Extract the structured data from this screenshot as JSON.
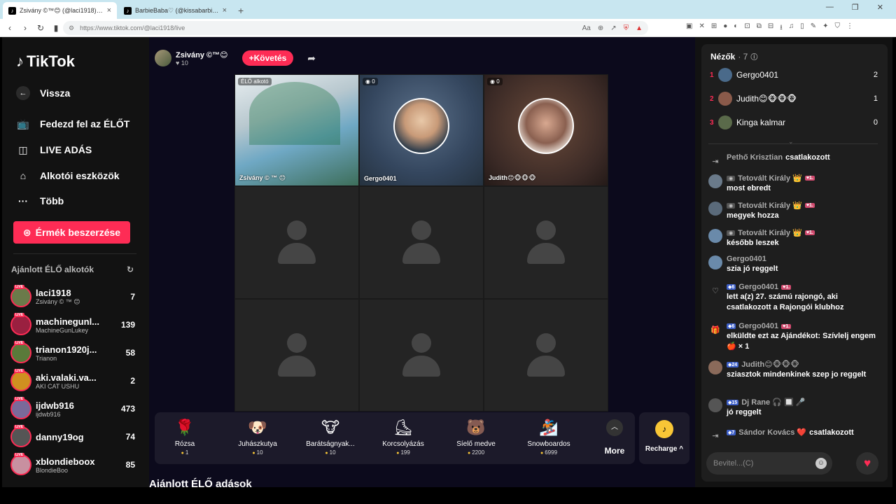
{
  "browser": {
    "tabs": [
      {
        "title": "Zsivány ©™😊 (@laci1918) É...",
        "active": true
      },
      {
        "title": "BarbieBaba♡ (@kissabarbie) ÉLŐ ad...",
        "active": false
      }
    ],
    "url": "https://www.tiktok.com/@laci1918/live"
  },
  "leftnav": {
    "logo": "TikTok",
    "back": "Vissza",
    "explore": "Fedezd fel az ÉLŐT",
    "live": "LIVE ADÁS",
    "tools": "Alkotói eszközök",
    "more": "Több",
    "coins": "Érmék beszerzése",
    "rec_title": "Ajánlott ÉLŐ alkotók",
    "creators": [
      {
        "name": "laci1918",
        "sub": "Zsivány © ™ 😊",
        "count": "7",
        "color": "#6b7a4a"
      },
      {
        "name": "machinegunl...",
        "sub": "MachineGunLukey",
        "count": "139",
        "color": "#9a2040"
      },
      {
        "name": "trianon1920j...",
        "sub": "Trianon",
        "count": "58",
        "color": "#5a7a3a"
      },
      {
        "name": "aki.valaki.va...",
        "sub": "AKI CAT USHU",
        "count": "2",
        "color": "#d09020"
      },
      {
        "name": "ijdwb916",
        "sub": "ijdwb916",
        "count": "473",
        "color": "#7a6a9a"
      },
      {
        "name": "danny19og",
        "sub": "",
        "count": "74",
        "color": "#555555"
      },
      {
        "name": "xblondieboox",
        "sub": "BlondieBoo",
        "count": "85",
        "color": "#c890a0"
      }
    ]
  },
  "stream": {
    "host": "Zsivány ©™😊",
    "viewers": "10",
    "follow": "+Követés",
    "cells": [
      {
        "badge": "ÉLŐ alkotó",
        "name": "Zsivány © ™ 😊"
      },
      {
        "badge": "0",
        "name": "Gergo0401"
      },
      {
        "badge": "0",
        "name": "Judith😊🐵🐵🐵"
      }
    ],
    "gifts": [
      {
        "icon": "🌹",
        "name": "Rózsa",
        "price": "1"
      },
      {
        "icon": "🐶",
        "name": "Juhászkutya",
        "price": "10"
      },
      {
        "icon": "🐮",
        "name": "Barátságnyak...",
        "price": "10"
      },
      {
        "icon": "⛸",
        "name": "Korcsolyázás",
        "price": "199"
      },
      {
        "icon": "🐻",
        "name": "Síelő medve",
        "price": "2200"
      },
      {
        "icon": "🏂",
        "name": "Snowboardos",
        "price": "6999"
      }
    ],
    "more": "More",
    "recharge": "Recharge ^",
    "recommended_heading": "Ajánlott ÉLŐ adások"
  },
  "panel": {
    "title": "Nézők",
    "count": "· 7",
    "viewers": [
      {
        "rank": "1",
        "name": "Gergo0401",
        "score": "2",
        "color": "#4a6a8a"
      },
      {
        "rank": "2",
        "name": "Judith😊🐵🐵🐵",
        "score": "1",
        "color": "#8a5a4a"
      },
      {
        "rank": "3",
        "name": "Kinga kalmar",
        "score": "0",
        "color": "#5a6a4a"
      }
    ],
    "messages": [
      {
        "user": "Pethő Krisztian",
        "text": "csatlakozott"
      },
      {
        "user": "Tetovált Király 👑",
        "badge": "1.",
        "text": "most ebredt"
      },
      {
        "user": "Tetovált Király 👑",
        "badge": "1.",
        "text": "megyek hozza"
      },
      {
        "user": "Tetovált Király 👑",
        "badge": "1.",
        "text": "később leszek"
      },
      {
        "user": "Gergo0401",
        "text": "szia jó reggelt"
      },
      {
        "lvl": "6",
        "user": "Gergo0401",
        "badge": "1.",
        "text": "lett a(z) 27. számú rajongó, aki csatlakozott a Rajongói klubhoz"
      },
      {
        "lvl": "6",
        "user": "Gergo0401",
        "badge": "1.",
        "text": "elküldte ezt az Ajándékot: Szívlelj engem 🍎 × 1"
      },
      {
        "lvl": "24",
        "user": "Judith😊🐵🐵🐵",
        "text": "sziasztok mindenkinek szep jo reggelt"
      },
      {
        "lvl": "15",
        "user": "Dj Rane 🎧 🔲 🎤",
        "text": "jó reggelt"
      },
      {
        "lvl": "7",
        "user": "Sándor Kovács ❤️",
        "text": "csatlakozott"
      }
    ],
    "input_placeholder": "Bevitel...(C)"
  }
}
